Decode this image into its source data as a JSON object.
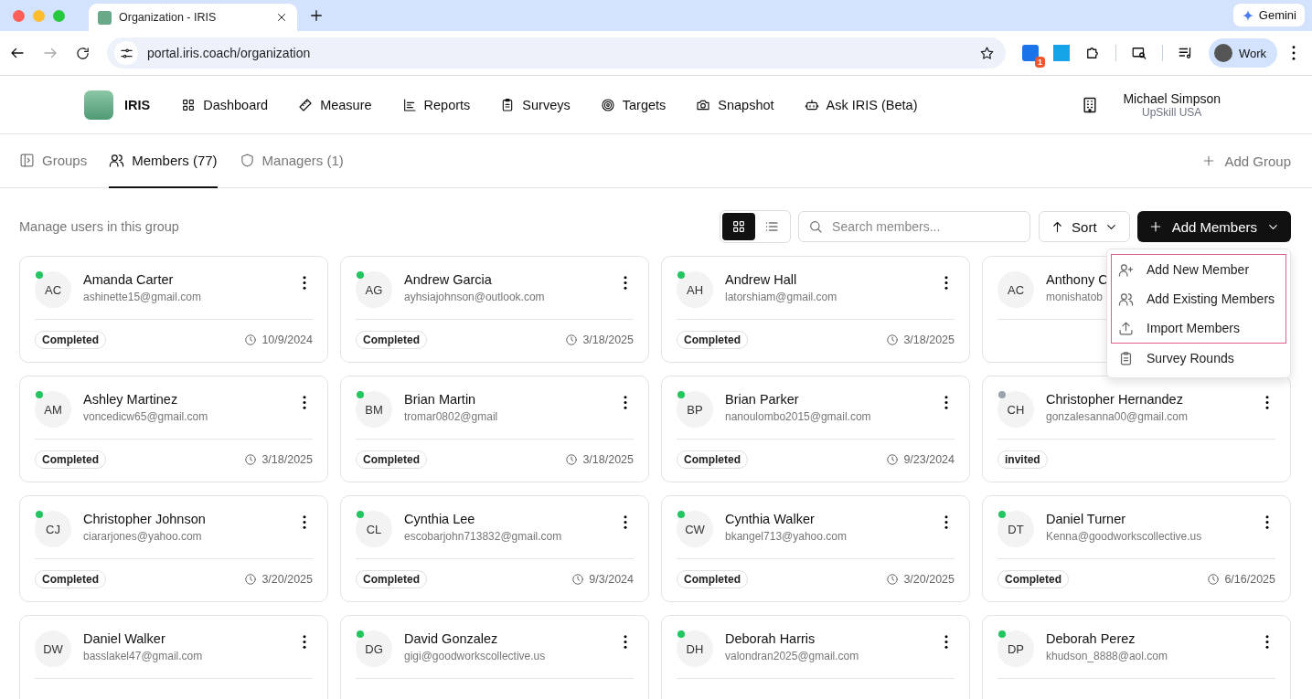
{
  "browser": {
    "tab_title": "Organization - IRIS",
    "url": "portal.iris.coach/organization",
    "gemini": "Gemini",
    "extension_badge": "1",
    "profile": "Work"
  },
  "app": {
    "brand": "IRIS",
    "nav": [
      {
        "label": "Dashboard",
        "kind": "grid"
      },
      {
        "label": "Measure",
        "kind": "ruler"
      },
      {
        "label": "Reports",
        "kind": "chart"
      },
      {
        "label": "Surveys",
        "kind": "clipboard"
      },
      {
        "label": "Targets",
        "kind": "target"
      },
      {
        "label": "Snapshot",
        "kind": "camera"
      },
      {
        "label": "Ask IRIS (Beta)",
        "kind": "bot"
      }
    ],
    "user": {
      "name": "Michael Simpson",
      "org": "UpSkill USA"
    }
  },
  "tabs": [
    {
      "label": "Groups",
      "kind": "panel",
      "selected": false
    },
    {
      "label": "Members (77)",
      "kind": "users",
      "selected": true
    },
    {
      "label": "Managers (1)",
      "kind": "shield",
      "selected": false
    }
  ],
  "add_group": "Add Group",
  "subtitle": "Manage users in this group",
  "view_toggle": [
    {
      "kind": "grid",
      "selected": true
    },
    {
      "kind": "list",
      "selected": false
    }
  ],
  "search": {
    "placeholder": "Search members..."
  },
  "sort": "Sort",
  "add_members": "Add Members",
  "menu": [
    {
      "label": "Add New Member",
      "kind": "user-plus",
      "highlighted": true
    },
    {
      "label": "Add Existing Members",
      "kind": "users",
      "highlighted": true
    },
    {
      "label": "Import Members",
      "kind": "upload",
      "highlighted": true
    },
    {
      "label": "Survey Rounds",
      "kind": "clipboard",
      "highlighted": false
    }
  ],
  "members": [
    {
      "initials": "AC",
      "name": "Amanda Carter",
      "email": "ashinette15@gmail.com",
      "color": "#22c55e",
      "status": "Completed",
      "date": "10/9/2024"
    },
    {
      "initials": "AG",
      "name": "Andrew Garcia",
      "email": "ayhsiajohnson@outlook.com",
      "color": "#22c55e",
      "status": "Completed",
      "date": "3/18/2025"
    },
    {
      "initials": "AH",
      "name": "Andrew Hall",
      "email": "latorshiam@gmail.com",
      "color": "#22c55e",
      "status": "Completed",
      "date": "3/18/2025"
    },
    {
      "initials": "AC",
      "name": "Anthony C",
      "email": "monishatob"
    },
    {
      "initials": "AM",
      "name": "Ashley Martinez",
      "email": "voncedicw65@gmail.com",
      "color": "#22c55e",
      "status": "Completed",
      "date": "3/18/2025"
    },
    {
      "initials": "BM",
      "name": "Brian Martin",
      "email": "tromar0802@gmail",
      "color": "#22c55e",
      "status": "Completed",
      "date": "3/18/2025"
    },
    {
      "initials": "BP",
      "name": "Brian Parker",
      "email": "nanoulombo2015@gmail.com",
      "color": "#22c55e",
      "status": "Completed",
      "date": "9/23/2024"
    },
    {
      "initials": "CH",
      "name": "Christopher Hernandez",
      "email": "gonzalesanna00@gmail.com",
      "color": "#9ca3af",
      "status": "invited"
    },
    {
      "initials": "CJ",
      "name": "Christopher Johnson",
      "email": "ciararjones@yahoo.com",
      "color": "#22c55e",
      "status": "Completed",
      "date": "3/20/2025"
    },
    {
      "initials": "CL",
      "name": "Cynthia Lee",
      "email": "escobarjohn713832@gmail.com",
      "color": "#22c55e",
      "status": "Completed",
      "date": "9/3/2024"
    },
    {
      "initials": "CW",
      "name": "Cynthia Walker",
      "email": "bkangel713@yahoo.com",
      "color": "#22c55e",
      "status": "Completed",
      "date": "3/20/2025"
    },
    {
      "initials": "DT",
      "name": "Daniel Turner",
      "email": "Kenna@goodworkscollective.us",
      "color": "#22c55e",
      "status": "Completed",
      "date": "6/16/2025"
    },
    {
      "initials": "DW",
      "name": "Daniel Walker",
      "email": "basslakel47@gmail.com"
    },
    {
      "initials": "DG",
      "name": "David Gonzalez",
      "email": "gigi@goodworkscollective.us",
      "color": "#22c55e"
    },
    {
      "initials": "DH",
      "name": "Deborah Harris",
      "email": "valondran2025@gmail.com",
      "color": "#22c55e"
    },
    {
      "initials": "DP",
      "name": "Deborah Perez",
      "email": "khudson_8888@aol.com",
      "color": "#22c55e"
    }
  ]
}
